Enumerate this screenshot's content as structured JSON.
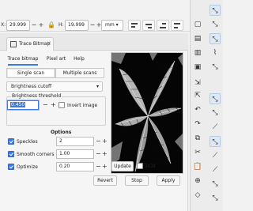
{
  "toolbar": {
    "x_label": "X:",
    "x_value": "29.999",
    "y_label": "H:",
    "h_value": "19.999",
    "unit": "mm",
    "minus": "−",
    "plus": "+",
    "lock_icon": "lock-icon"
  },
  "dock_tab": {
    "label": "Trace Bitmap",
    "close": "✕"
  },
  "tabs": [
    "Trace bitmap",
    "Pixel art",
    "Help"
  ],
  "scan_modes": [
    "Single scan",
    "Multiple scans"
  ],
  "mode": "Brightness cutoff",
  "threshold": {
    "label": "Brightness threshold",
    "value": "0.450",
    "invert_label": "Invert image"
  },
  "options": {
    "title": "Options",
    "items": [
      {
        "label": "Speckles",
        "value": "2",
        "checked": true
      },
      {
        "label": "Smooth corners",
        "value": "1.00",
        "checked": true
      },
      {
        "label": "Optimize",
        "value": "0.20",
        "checked": true
      }
    ]
  },
  "preview": {
    "update_label": "Update",
    "siox_label": "SIOX"
  },
  "buttons": {
    "revert": "Revert",
    "stop": "Stop",
    "apply": "Apply"
  },
  "right_icons": [
    "snap-icon",
    "new-document-icon",
    "open-document-icon",
    "save-icon",
    "print-icon",
    "import-icon",
    "export-icon",
    "undo-icon",
    "redo-icon",
    "copy-icon",
    "cut-icon",
    "paste-icon",
    "zoom-icon",
    "node-icon"
  ]
}
